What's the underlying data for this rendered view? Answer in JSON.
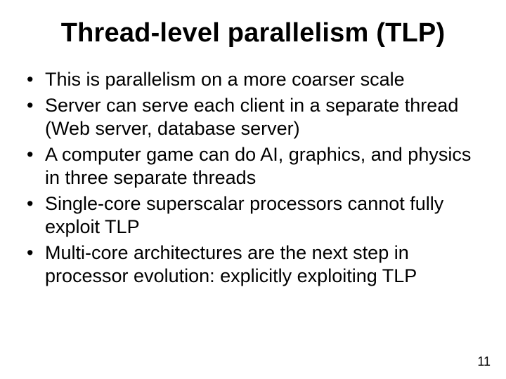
{
  "slide": {
    "title": "Thread-level parallelism (TLP)",
    "bullets": [
      "This is parallelism on a more coarser scale",
      "Server can serve each client in a separate thread (Web server, database server)",
      "A computer game can do AI, graphics, and physics in three separate threads",
      "Single-core superscalar processors cannot fully exploit TLP",
      "Multi-core architectures are the next step in processor evolution: explicitly exploiting TLP"
    ],
    "page_number": "11"
  }
}
